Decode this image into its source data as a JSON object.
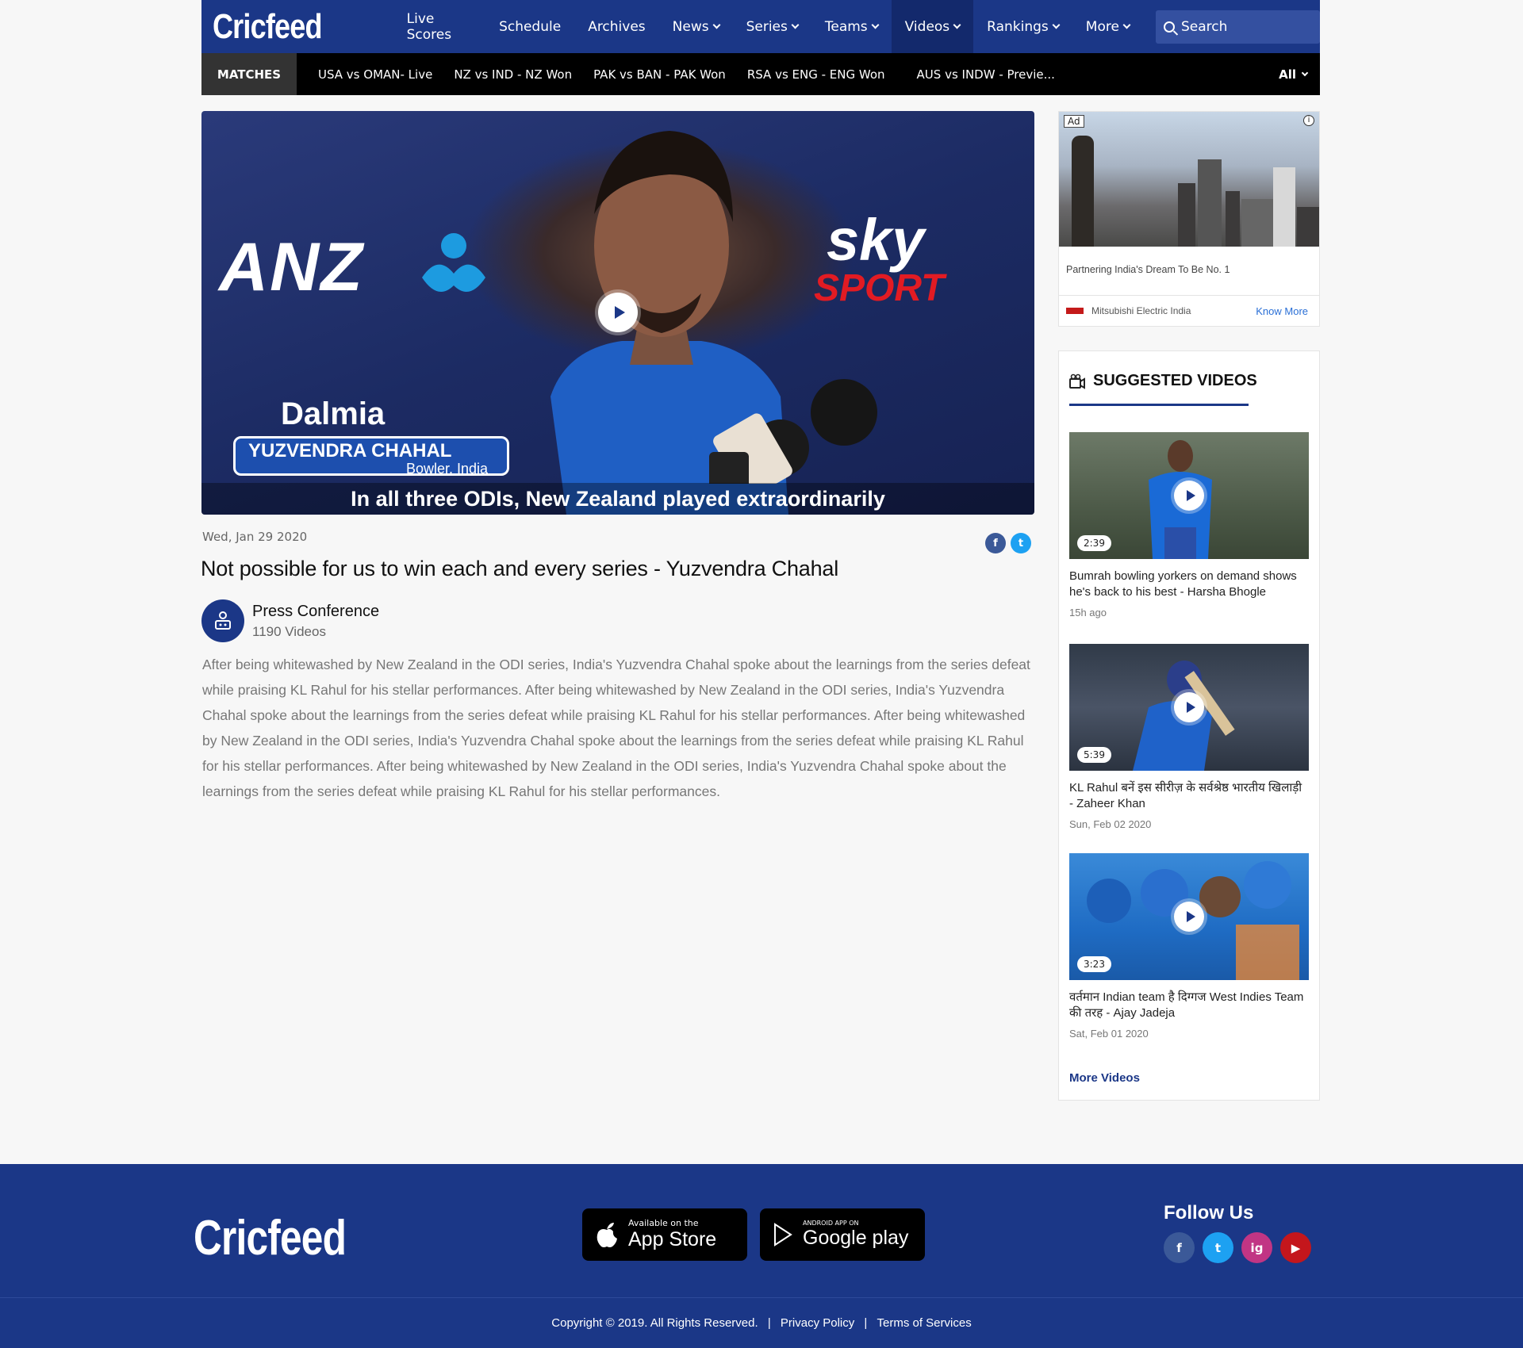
{
  "header": {
    "logo": "Cricfeed",
    "nav": [
      {
        "label": "Live Scores",
        "dropdown": false
      },
      {
        "label": "Schedule",
        "dropdown": false
      },
      {
        "label": "Archives",
        "dropdown": false
      },
      {
        "label": "News",
        "dropdown": true
      },
      {
        "label": "Series",
        "dropdown": true
      },
      {
        "label": "Teams",
        "dropdown": true
      },
      {
        "label": "Videos",
        "dropdown": true,
        "active": true
      },
      {
        "label": "Rankings",
        "dropdown": true
      },
      {
        "label": "More",
        "dropdown": true
      }
    ],
    "search_placeholder": "Search"
  },
  "matches": {
    "label": "MATCHES",
    "items": [
      "USA vs OMAN- Live",
      "NZ vs IND - NZ Won",
      "PAK vs BAN - PAK Won",
      "RSA vs  ENG - ENG Won",
      "AUS vs INDW - Previe..."
    ],
    "filter": "All"
  },
  "video": {
    "overlay": {
      "sponsor1": "ANZ",
      "sponsor2": "sky",
      "sponsor3": "SPORT",
      "sponsor4": "Dalmia",
      "player_name": "YUZVENDRA CHAHAL",
      "player_role": "Bowler, India",
      "caption": "In all three ODIs, New Zealand played extraordinarily"
    },
    "date": "Wed, Jan 29 2020",
    "title": "Not possible for us to win each and every series - Yuzvendra Chahal",
    "channel": {
      "name": "Press Conference",
      "count": "1190 Videos"
    },
    "description": "After being whitewashed by New Zealand in the ODI series, India's Yuzvendra Chahal spoke about the learnings from the series defeat while praising KL Rahul for his stellar performances. After being whitewashed by New Zealand in the ODI series, India's Yuzvendra Chahal spoke about the learnings from the series defeat while praising KL Rahul for his stellar performances. After being whitewashed by New Zealand in the ODI series, India's Yuzvendra Chahal spoke about the learnings from the series defeat while praising KL Rahul for his stellar performances. After being whitewashed by New Zealand in the ODI series, India's Yuzvendra Chahal spoke about the learnings from the series defeat while praising KL Rahul for his stellar performances."
  },
  "share": {
    "facebook": "f",
    "twitter": "t",
    "facebook_color": "#3b5998",
    "twitter_color": "#1da1f2"
  },
  "ad": {
    "tag": "Ad",
    "info": "i",
    "headline": "Partnering India's Dream To Be No. 1",
    "advertiser": "Mitsubishi Electric India",
    "cta": "Know More"
  },
  "suggested": {
    "heading": "SUGGESTED VIDEOS",
    "videos": [
      {
        "duration": "2:39",
        "title": "Bumrah bowling yorkers on demand shows he's back to his best - Harsha Bhogle",
        "meta": "15h ago"
      },
      {
        "duration": "5:39",
        "title": "KL Rahul बनें इस सीरीज़ के सर्वश्रेष्ठ भारतीय खिलाड़ी  - Zaheer Khan",
        "meta": "Sun, Feb 02 2020"
      },
      {
        "duration": "3:23",
        "title": "वर्तमान Indian team है दिग्गज West Indies Team की तरह - Ajay Jadeja",
        "meta": "Sat, Feb 01 2020"
      }
    ],
    "more": "More Videos"
  },
  "footer": {
    "logo": "Cricfeed",
    "appstore_small": "Available on the",
    "appstore_big": "App Store",
    "play_small": "ANDROID APP ON",
    "play_big": "Google play",
    "follow": "Follow Us",
    "socials": {
      "facebook": "f",
      "twitter": "t",
      "instagram": "ig",
      "youtube": "▶"
    },
    "copyright": "Copyright © 2019. All Rights Reserved.",
    "privacy": "Privacy Policy",
    "terms": "Terms of Services",
    "separator": "|"
  },
  "colors": {
    "brand": "#1b3787",
    "brand_dark": "#13296c",
    "instagram": "#c13584",
    "youtube": "#c4161c"
  }
}
